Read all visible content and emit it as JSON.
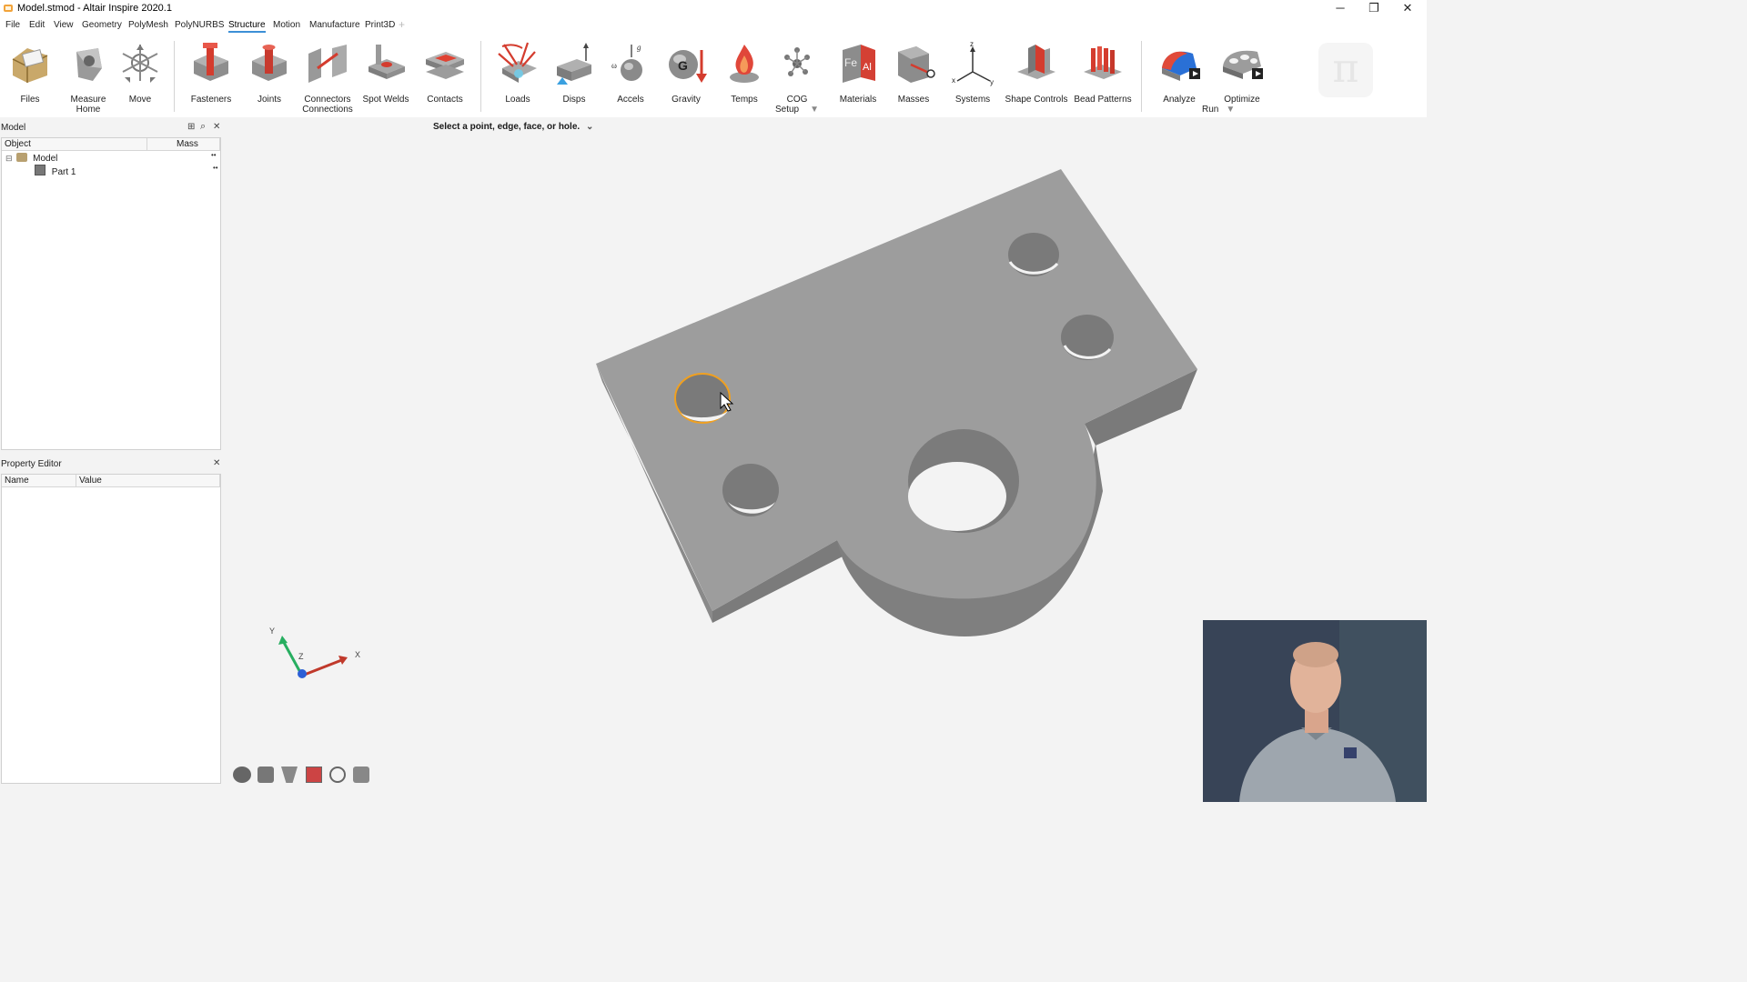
{
  "window": {
    "title": "Model.stmod - Altair Inspire 2020.1",
    "minimize": "─",
    "restore": "❐",
    "close": "✕"
  },
  "menu": {
    "items": [
      "File",
      "Edit",
      "View",
      "Geometry",
      "PolyMesh",
      "PolyNURBS",
      "Structure",
      "Motion",
      "Manufacture",
      "Print3D"
    ],
    "active": "Structure",
    "add_tab": "+"
  },
  "ribbon": {
    "tools": [
      {
        "label": "Files",
        "icon": "folder-icon"
      },
      {
        "label": "Measure",
        "sub": "Home",
        "icon": "measure-icon"
      },
      {
        "label": "Move",
        "icon": "move-icon"
      },
      {
        "label": "Fasteners",
        "icon": "fasteners-icon"
      },
      {
        "label": "Joints",
        "icon": "joints-icon"
      },
      {
        "label": "Connectors",
        "sub": "Connections",
        "icon": "connectors-icon"
      },
      {
        "label": "Spot Welds",
        "icon": "spot-welds-icon"
      },
      {
        "label": "Contacts",
        "icon": "contacts-icon"
      },
      {
        "label": "Loads",
        "icon": "loads-icon"
      },
      {
        "label": "Disps",
        "icon": "disps-icon"
      },
      {
        "label": "Accels",
        "icon": "accels-icon"
      },
      {
        "label": "Gravity",
        "icon": "gravity-icon"
      },
      {
        "label": "Temps",
        "icon": "temps-icon"
      },
      {
        "label": "COG",
        "sub": "Setup",
        "icon": "cog-icon"
      },
      {
        "label": "Materials",
        "icon": "materials-icon"
      },
      {
        "label": "Masses",
        "icon": "masses-icon"
      },
      {
        "label": "Systems",
        "icon": "systems-icon"
      },
      {
        "label": "Shape Controls",
        "icon": "shape-controls-icon"
      },
      {
        "label": "Bead Patterns",
        "icon": "bead-patterns-icon"
      },
      {
        "label": "Analyze",
        "sub": "Run",
        "icon": "analyze-icon"
      },
      {
        "label": "Optimize",
        "icon": "optimize-icon"
      }
    ],
    "material_text_fe": "Fe",
    "material_text_al": "Al",
    "gravity_letter": "G",
    "accels_g": "g",
    "accels_w": "ω",
    "systems_x": "x",
    "systems_y": "y",
    "systems_z": "z",
    "brand_logo": "π"
  },
  "model_panel": {
    "title": "Model",
    "columns": [
      "Object",
      "Mass"
    ],
    "rows": [
      {
        "name": "Model",
        "expander": "⊟",
        "more": "••"
      },
      {
        "name": "Part 1",
        "more": "••"
      }
    ]
  },
  "property_editor": {
    "title": "Property Editor",
    "columns": [
      "Name",
      "Value"
    ]
  },
  "viewport": {
    "prompt": "Select a point, edge, face, or hole.",
    "triad": {
      "y": "Y",
      "z": "Z",
      "x": "X"
    },
    "part_color": "#9d9d9d",
    "highlight_color": "#f0a020"
  },
  "colors": {
    "accent": "#3c8fd6",
    "axis_x": "#c0392b",
    "axis_y": "#27ae60",
    "axis_z": "#2c5fd6"
  }
}
